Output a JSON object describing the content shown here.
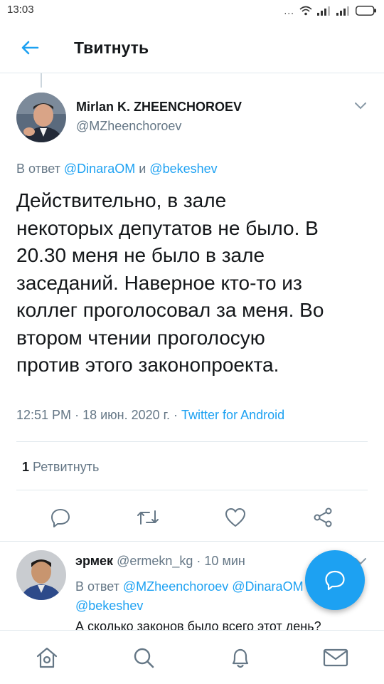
{
  "status_bar": {
    "time": "13:03",
    "icons": [
      "more-dots-icon",
      "wifi-icon",
      "signal-icon",
      "signal-icon",
      "battery-icon"
    ],
    "dots": "..."
  },
  "header": {
    "title": "Твитнуть",
    "back_icon": "back-arrow-icon"
  },
  "tweet": {
    "author_name": "Mirlan K. ZHEENCHOROEV",
    "author_handle": "@MZheenchoroev",
    "reply_prefix": "В ответ",
    "reply_user1": "@DinaraOM",
    "reply_and": "и",
    "reply_user2": "@bekeshev",
    "text": "Действительно,  в зале\nнекоторых депутатов не было. В\n20.30 меня не было в зале\nзаседаний. Наверное  кто-то из\nколлег проголосовал за меня. Во\nвтором чтении проголосую\nпротив этого законопроекта.",
    "time": "12:51 PM",
    "date": "18 июн. 2020 г.",
    "source": "Twitter for Android",
    "retweet_count": "1",
    "retweet_label": "Ретвитнуть"
  },
  "actions": [
    {
      "name": "reply",
      "icon": "reply-icon"
    },
    {
      "name": "retweet",
      "icon": "retweet-icon"
    },
    {
      "name": "like",
      "icon": "heart-icon"
    },
    {
      "name": "share",
      "icon": "share-icon"
    }
  ],
  "reply": {
    "name": "эрмек",
    "handle": "@ermekn_kg",
    "time": "10 мин",
    "reply_prefix": "В ответ",
    "reply_user1": "@MZheenchoroev",
    "reply_user2": "@DinaraOM",
    "reply_user3": "@bekeshev",
    "text": "А сколько законов было всего этот день?"
  },
  "fab": {
    "icon": "compose-reply-icon"
  },
  "bottom_nav": [
    {
      "name": "home",
      "icon": "home-icon"
    },
    {
      "name": "search",
      "icon": "search-icon"
    },
    {
      "name": "notifications",
      "icon": "bell-icon"
    },
    {
      "name": "messages",
      "icon": "mail-icon"
    }
  ],
  "colors": {
    "accent": "#1da1f2",
    "text": "#14171a",
    "muted": "#657786",
    "divider": "#e1e8ed"
  }
}
